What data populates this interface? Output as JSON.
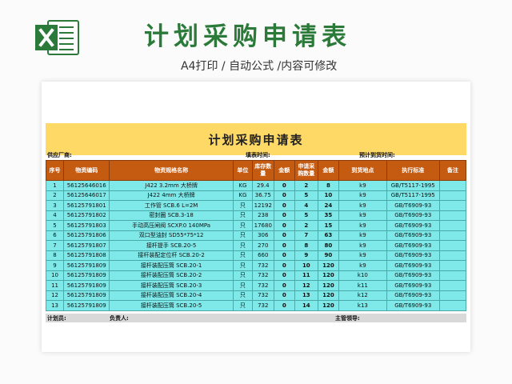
{
  "banner": {
    "title": "计划采购申请表",
    "subtitle": "A4打印 / 自动公式 /内容可修改"
  },
  "colors": {
    "brand_green": "#2b7a3a",
    "header_orange": "#c55a11",
    "title_yellow": "#ffd966",
    "row_cyan": "#7fe9e9"
  },
  "sheet": {
    "title": "计划采购申请表",
    "supplier_label": "供应厂商:",
    "fill_date_label": "填表时间:",
    "arrival_label": "预计到货时间:",
    "columns": [
      "序号",
      "物资编码",
      "物资规格名称",
      "单位",
      "库存数量",
      "金额",
      "申请采购数量",
      "金额",
      "到货地点",
      "执行标准",
      "备注"
    ],
    "rows": [
      [
        "1",
        "56125646016",
        "J422  3.2mm  大桥牌",
        "KG",
        "29.4",
        "0",
        "2",
        "8",
        "k9",
        "GB/T5117-1995",
        ""
      ],
      [
        "2",
        "56125646017",
        "J422  4mm  大桥牌",
        "KG",
        "36.75",
        "0",
        "5",
        "10",
        "k9",
        "GB/T5117-1995",
        ""
      ],
      [
        "3",
        "56125791801",
        "工作管  SCB.6 L=2M",
        "只",
        "12192",
        "0",
        "4",
        "24",
        "k9",
        "GB/T6909-93",
        ""
      ],
      [
        "4",
        "56125791802",
        "密封圈  SCB.3-18",
        "只",
        "238",
        "0",
        "5",
        "35",
        "k9",
        "GB/T6909-93",
        ""
      ],
      [
        "5",
        "56125791803",
        "手动高压闸阀  SCXP.0 140MPa",
        "只",
        "17680",
        "0",
        "2",
        "15",
        "k9",
        "GB/T6909-93",
        ""
      ],
      [
        "6",
        "56125791806",
        "双口型油封  SD55*75*12",
        "只",
        "306",
        "0",
        "7",
        "63",
        "k9",
        "GB/T6909-93",
        ""
      ],
      [
        "7",
        "56125791807",
        "接杆提手  SCB.20-5",
        "只",
        "270",
        "0",
        "8",
        "80",
        "k9",
        "GB/T6909-93",
        ""
      ],
      [
        "8",
        "56125791808",
        "接杆装配定位杆  SCB.20-2",
        "只",
        "660",
        "0",
        "9",
        "90",
        "k9",
        "GB/T6909-93",
        ""
      ],
      [
        "9",
        "56125791809",
        "接杆装配压筒  SCB.20-1",
        "只",
        "732",
        "0",
        "10",
        "120",
        "k9",
        "GB/T6909-93",
        ""
      ],
      [
        "10",
        "56125791809",
        "接杆装配压筒  SCB.20-2",
        "只",
        "732",
        "0",
        "11",
        "120",
        "k10",
        "GB/T6909-93",
        ""
      ],
      [
        "11",
        "56125791809",
        "接杆装配压筒  SCB.20-3",
        "只",
        "732",
        "0",
        "12",
        "120",
        "k11",
        "GB/T6909-93",
        ""
      ],
      [
        "12",
        "56125791809",
        "接杆装配压筒  SCB.20-4",
        "只",
        "732",
        "0",
        "13",
        "120",
        "k12",
        "GB/T6909-93",
        ""
      ],
      [
        "13",
        "56125791809",
        "接杆装配压筒  SCB.20-5",
        "只",
        "732",
        "0",
        "14",
        "120",
        "k13",
        "GB/T6909-93",
        ""
      ]
    ],
    "footer": {
      "planner_label": "计划员:",
      "owner_label": "负责人:",
      "supervisor_label": "主管领导:"
    }
  }
}
